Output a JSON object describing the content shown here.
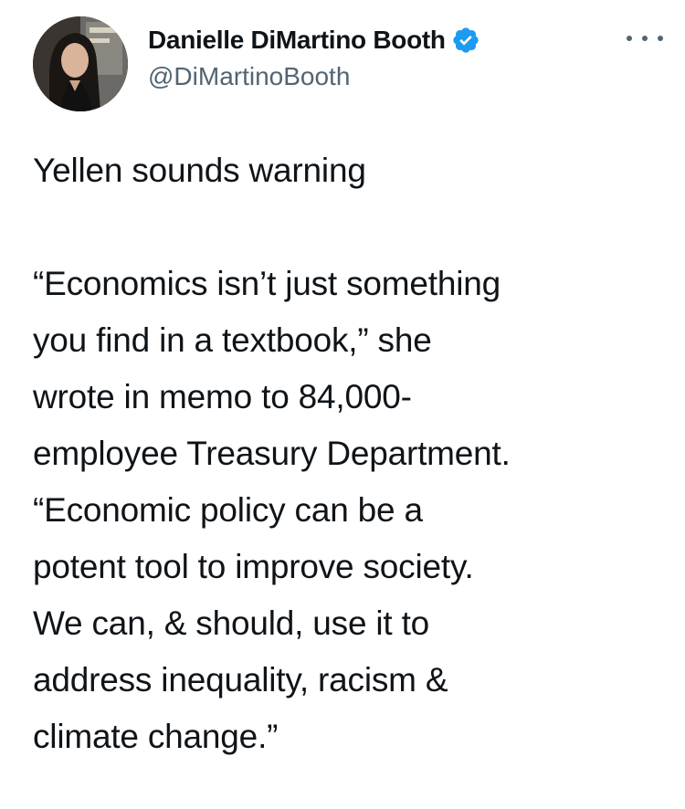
{
  "tweet": {
    "author": {
      "display_name": "Danielle DiMartino Booth",
      "handle": "@DiMartinoBooth",
      "verified": true,
      "avatar_icon": "profile-photo",
      "verified_icon": "verified-badge-icon"
    },
    "more_icon": "more-options-icon",
    "text_lines": [
      "Yellen sounds warning",
      "",
      "“Economics isn’t just something",
      "you find in a textbook,” she",
      "wrote in memo to 84,000-",
      "employee Treasury Department.",
      "“Economic policy can be a",
      "potent tool to improve society.",
      "We can, & should, use it to",
      "address inequality, racism &",
      "climate change.”"
    ]
  },
  "colors": {
    "text": "#0f1419",
    "secondary": "#536471",
    "verified": "#1d9bf0",
    "background": "#ffffff"
  }
}
